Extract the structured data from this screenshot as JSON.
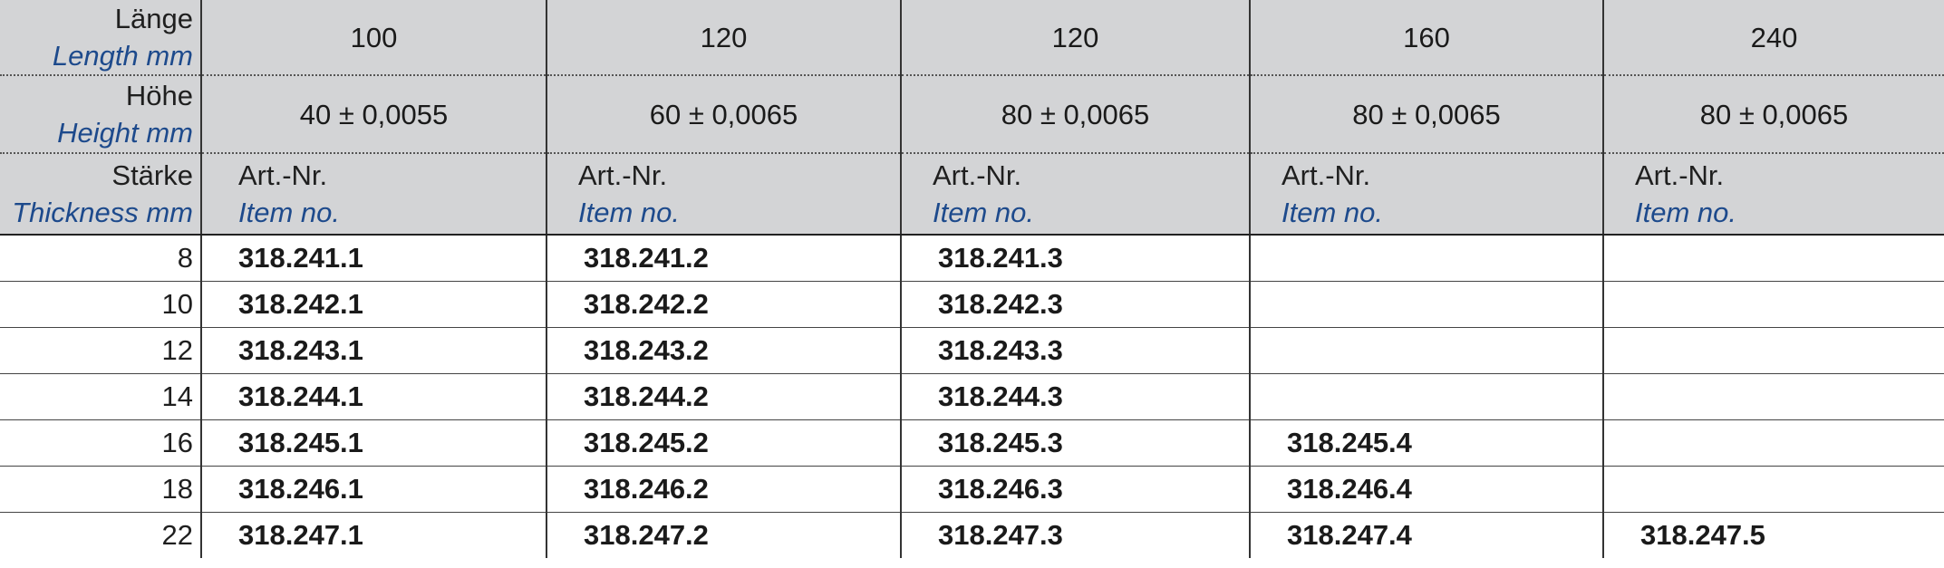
{
  "header": {
    "length": {
      "de": "Länge",
      "en": "Length mm",
      "values": [
        "100",
        "120",
        "120",
        "160",
        "240"
      ]
    },
    "height": {
      "de": "Höhe",
      "en": "Height mm",
      "values": [
        "40 ± 0,0055",
        "60 ± 0,0065",
        "80 ± 0,0065",
        "80 ± 0,0065",
        "80 ± 0,0065"
      ]
    },
    "thickness": {
      "de": "Stärke",
      "en": "Thickness mm"
    },
    "item": {
      "de": "Art.-Nr.",
      "en": "Item no."
    }
  },
  "rows": [
    {
      "thickness": "8",
      "items": [
        "318.241.1",
        "318.241.2",
        "318.241.3",
        "",
        ""
      ]
    },
    {
      "thickness": "10",
      "items": [
        "318.242.1",
        "318.242.2",
        "318.242.3",
        "",
        ""
      ]
    },
    {
      "thickness": "12",
      "items": [
        "318.243.1",
        "318.243.2",
        "318.243.3",
        "",
        ""
      ]
    },
    {
      "thickness": "14",
      "items": [
        "318.244.1",
        "318.244.2",
        "318.244.3",
        "",
        ""
      ]
    },
    {
      "thickness": "16",
      "items": [
        "318.245.1",
        "318.245.2",
        "318.245.3",
        "318.245.4",
        ""
      ]
    },
    {
      "thickness": "18",
      "items": [
        "318.246.1",
        "318.246.2",
        "318.246.3",
        "318.246.4",
        ""
      ]
    },
    {
      "thickness": "22",
      "items": [
        "318.247.1",
        "318.247.2",
        "318.247.3",
        "318.247.4",
        "318.247.5"
      ]
    }
  ]
}
